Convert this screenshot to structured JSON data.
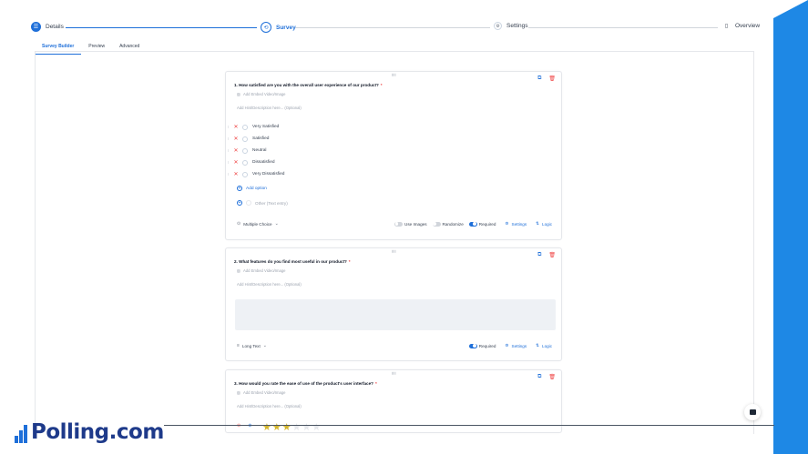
{
  "stepper": {
    "steps": [
      {
        "label": "Details",
        "icon": "list-icon",
        "state": "done"
      },
      {
        "label": "Survey",
        "icon": "survey-icon",
        "state": "active"
      },
      {
        "label": "Settings",
        "icon": "gear-icon",
        "state": "pending"
      },
      {
        "label": "Overview",
        "icon": "document-icon",
        "state": "pending"
      }
    ]
  },
  "tabs": [
    {
      "label": "Survey Builder",
      "active": true
    },
    {
      "label": "Preview",
      "active": false
    },
    {
      "label": "Advanced",
      "active": false
    }
  ],
  "common": {
    "embed_label": "Add Embed Video/Image",
    "hint_placeholder": "Add Hint/Description here... (Optional)",
    "required_label": "Required",
    "settings_label": "Settings",
    "logic_label": "Logic",
    "required_marker": "*"
  },
  "q1": {
    "title": "1.  How satisfied are you with the overall user experience of our product?",
    "options": [
      "Very Satisfied",
      "Satisfied",
      "Neutral",
      "Dissatisfied",
      "Very Dissatisfied"
    ],
    "add_option": "Add option",
    "other": "Other (Text entry)",
    "type": "Multiple Choice",
    "use_images": "Use Images",
    "randomize": "Randomize",
    "toggles": {
      "use_images": false,
      "randomize": false,
      "required": true
    }
  },
  "q2": {
    "title": "2.  What features do you find most useful in our product?",
    "type": "Long Text",
    "required": true
  },
  "q3": {
    "title": "3.  How would you rate the ease of use of the product's user interface?",
    "rating": 3,
    "rating_max": 6
  },
  "brand": {
    "name": "Polling.com",
    "primary": "#1e6fd9",
    "accent": "#1e88e5",
    "danger": "#ef4444"
  }
}
